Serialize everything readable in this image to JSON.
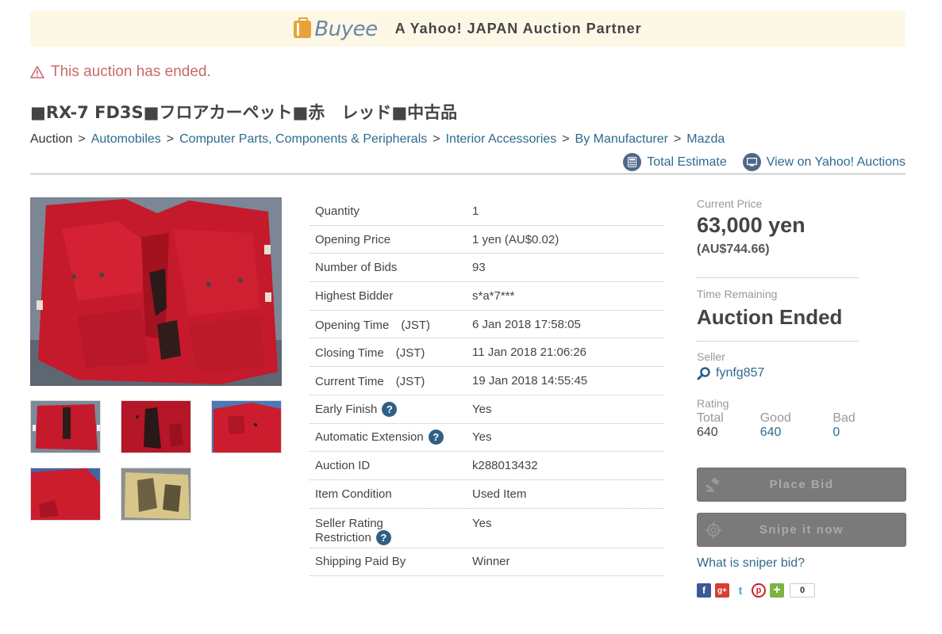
{
  "banner": {
    "logo_text": "Buyee",
    "tagline": "A Yahoo! JAPAN Auction Partner"
  },
  "status": {
    "message": "This auction has ended."
  },
  "item": {
    "title": "■RX-7 FD3S■フロアカーペット■赤　レッド■中古品"
  },
  "breadcrumb": {
    "root": "Auction",
    "separator": ">",
    "items": [
      "Automobiles",
      "Computer Parts, Components & Peripherals",
      "Interior Accessories",
      "By Manufacturer",
      "Mazda"
    ]
  },
  "tools": {
    "total_estimate": "Total Estimate",
    "view_yahoo": "View on Yahoo! Auctions"
  },
  "details": [
    {
      "label": "Quantity",
      "value": "1"
    },
    {
      "label": "Opening Price",
      "value": "1 yen (AU$0.02)"
    },
    {
      "label": "Number of Bids",
      "value": "93"
    },
    {
      "label": "Highest Bidder",
      "value": "s*a*7***"
    },
    {
      "label": "Opening Time　(JST)",
      "value": "6 Jan 2018 17:58:05"
    },
    {
      "label": "Closing Time　(JST)",
      "value": "11 Jan 2018 21:06:26"
    },
    {
      "label": "Current Time　(JST)",
      "value": "19 Jan 2018 14:55:45"
    },
    {
      "label": "Early Finish",
      "value": "Yes",
      "help": "?"
    },
    {
      "label": "Automatic Extension",
      "value": "Yes",
      "help": "?"
    },
    {
      "label": "Auction ID",
      "value": "k288013432"
    },
    {
      "label": "Item Condition",
      "value": "Used Item"
    },
    {
      "label_line1": "Seller Rating",
      "label_line2": "Restriction",
      "value": "Yes",
      "help": "?"
    },
    {
      "label": "Shipping Paid By",
      "value": "Winner"
    }
  ],
  "sidebar": {
    "current_price_label": "Current Price",
    "current_price": "63,000 yen",
    "current_price_aud": "(AU$744.66)",
    "time_remaining_label": "Time Remaining",
    "time_remaining": "Auction Ended",
    "seller_label": "Seller",
    "seller_name": "fynfg857",
    "rating_label": "Rating",
    "rating": {
      "total_label": "Total",
      "total": "640",
      "good_label": "Good",
      "good": "640",
      "bad_label": "Bad",
      "bad": "0"
    },
    "place_bid": "Place Bid",
    "snipe": "Snipe it now",
    "sniper_link": "What is sniper bid?",
    "share_count": "0"
  },
  "colors": {
    "link": "#2f6a8e",
    "alert": "#c9696b",
    "banner_bg": "#fdf8e6",
    "button_disabled": "#7a7a7a"
  }
}
